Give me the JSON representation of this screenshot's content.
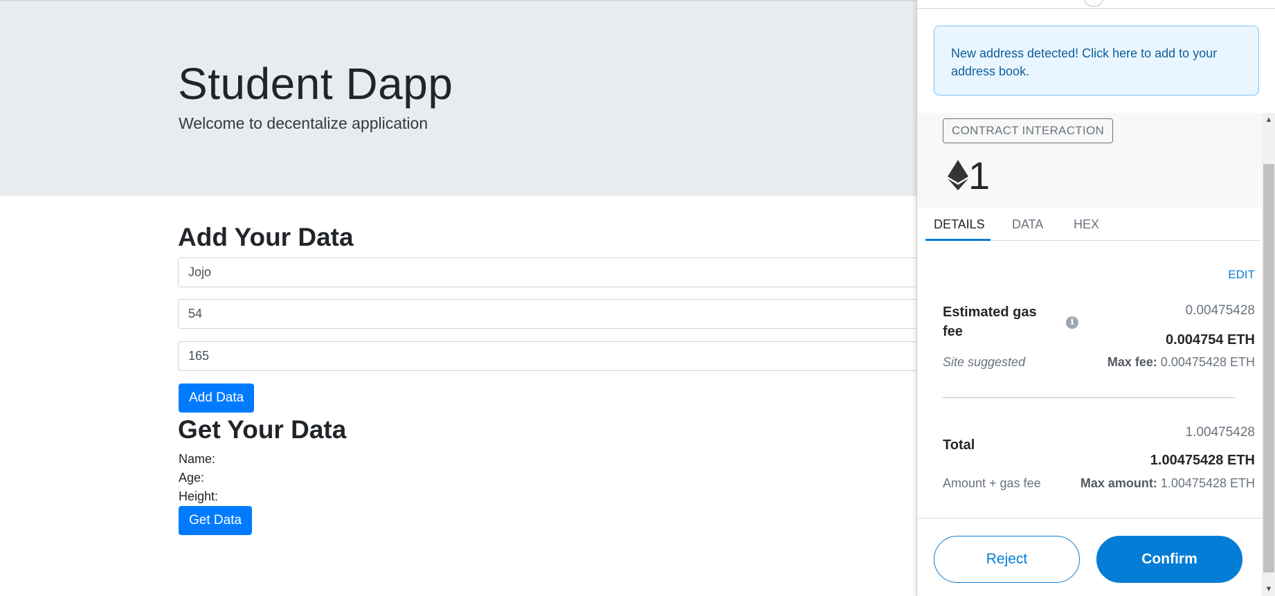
{
  "dapp": {
    "title": "Student Dapp",
    "subtitle": "Welcome to decentalize application",
    "add_section": {
      "heading": "Add Your Data",
      "name_value": "Jojo",
      "age_value": "54",
      "height_value": "165",
      "button_label": "Add Data"
    },
    "get_section": {
      "heading": "Get Your Data",
      "name_label": "Name:",
      "age_label": "Age:",
      "height_label": "Height:",
      "button_label": "Get Data"
    }
  },
  "metamask": {
    "alert_text": "New address detected! Click here to add to your address book.",
    "badge": "CONTRACT INTERACTION",
    "amount": "1",
    "tabs": [
      {
        "label": "DETAILS",
        "active": true
      },
      {
        "label": "DATA",
        "active": false
      },
      {
        "label": "HEX",
        "active": false
      }
    ],
    "edit_label": "EDIT",
    "gas": {
      "label": "Estimated gas fee",
      "value": "0.00475428",
      "value_bold": "0.004754 ETH",
      "suggestion": "Site suggested",
      "max_label": "Max fee:",
      "max_value": "0.00475428 ETH"
    },
    "total": {
      "label": "Total",
      "value": "1.00475428",
      "value_bold": "1.00475428 ETH",
      "sub_label": "Amount + gas fee",
      "max_label": "Max amount:",
      "max_value": "1.00475428 ETH"
    },
    "reject_label": "Reject",
    "confirm_label": "Confirm",
    "colors": {
      "primary_blue": "#037dd6",
      "alert_bg": "#eaf6ff",
      "bootstrap_primary": "#007bff"
    }
  }
}
